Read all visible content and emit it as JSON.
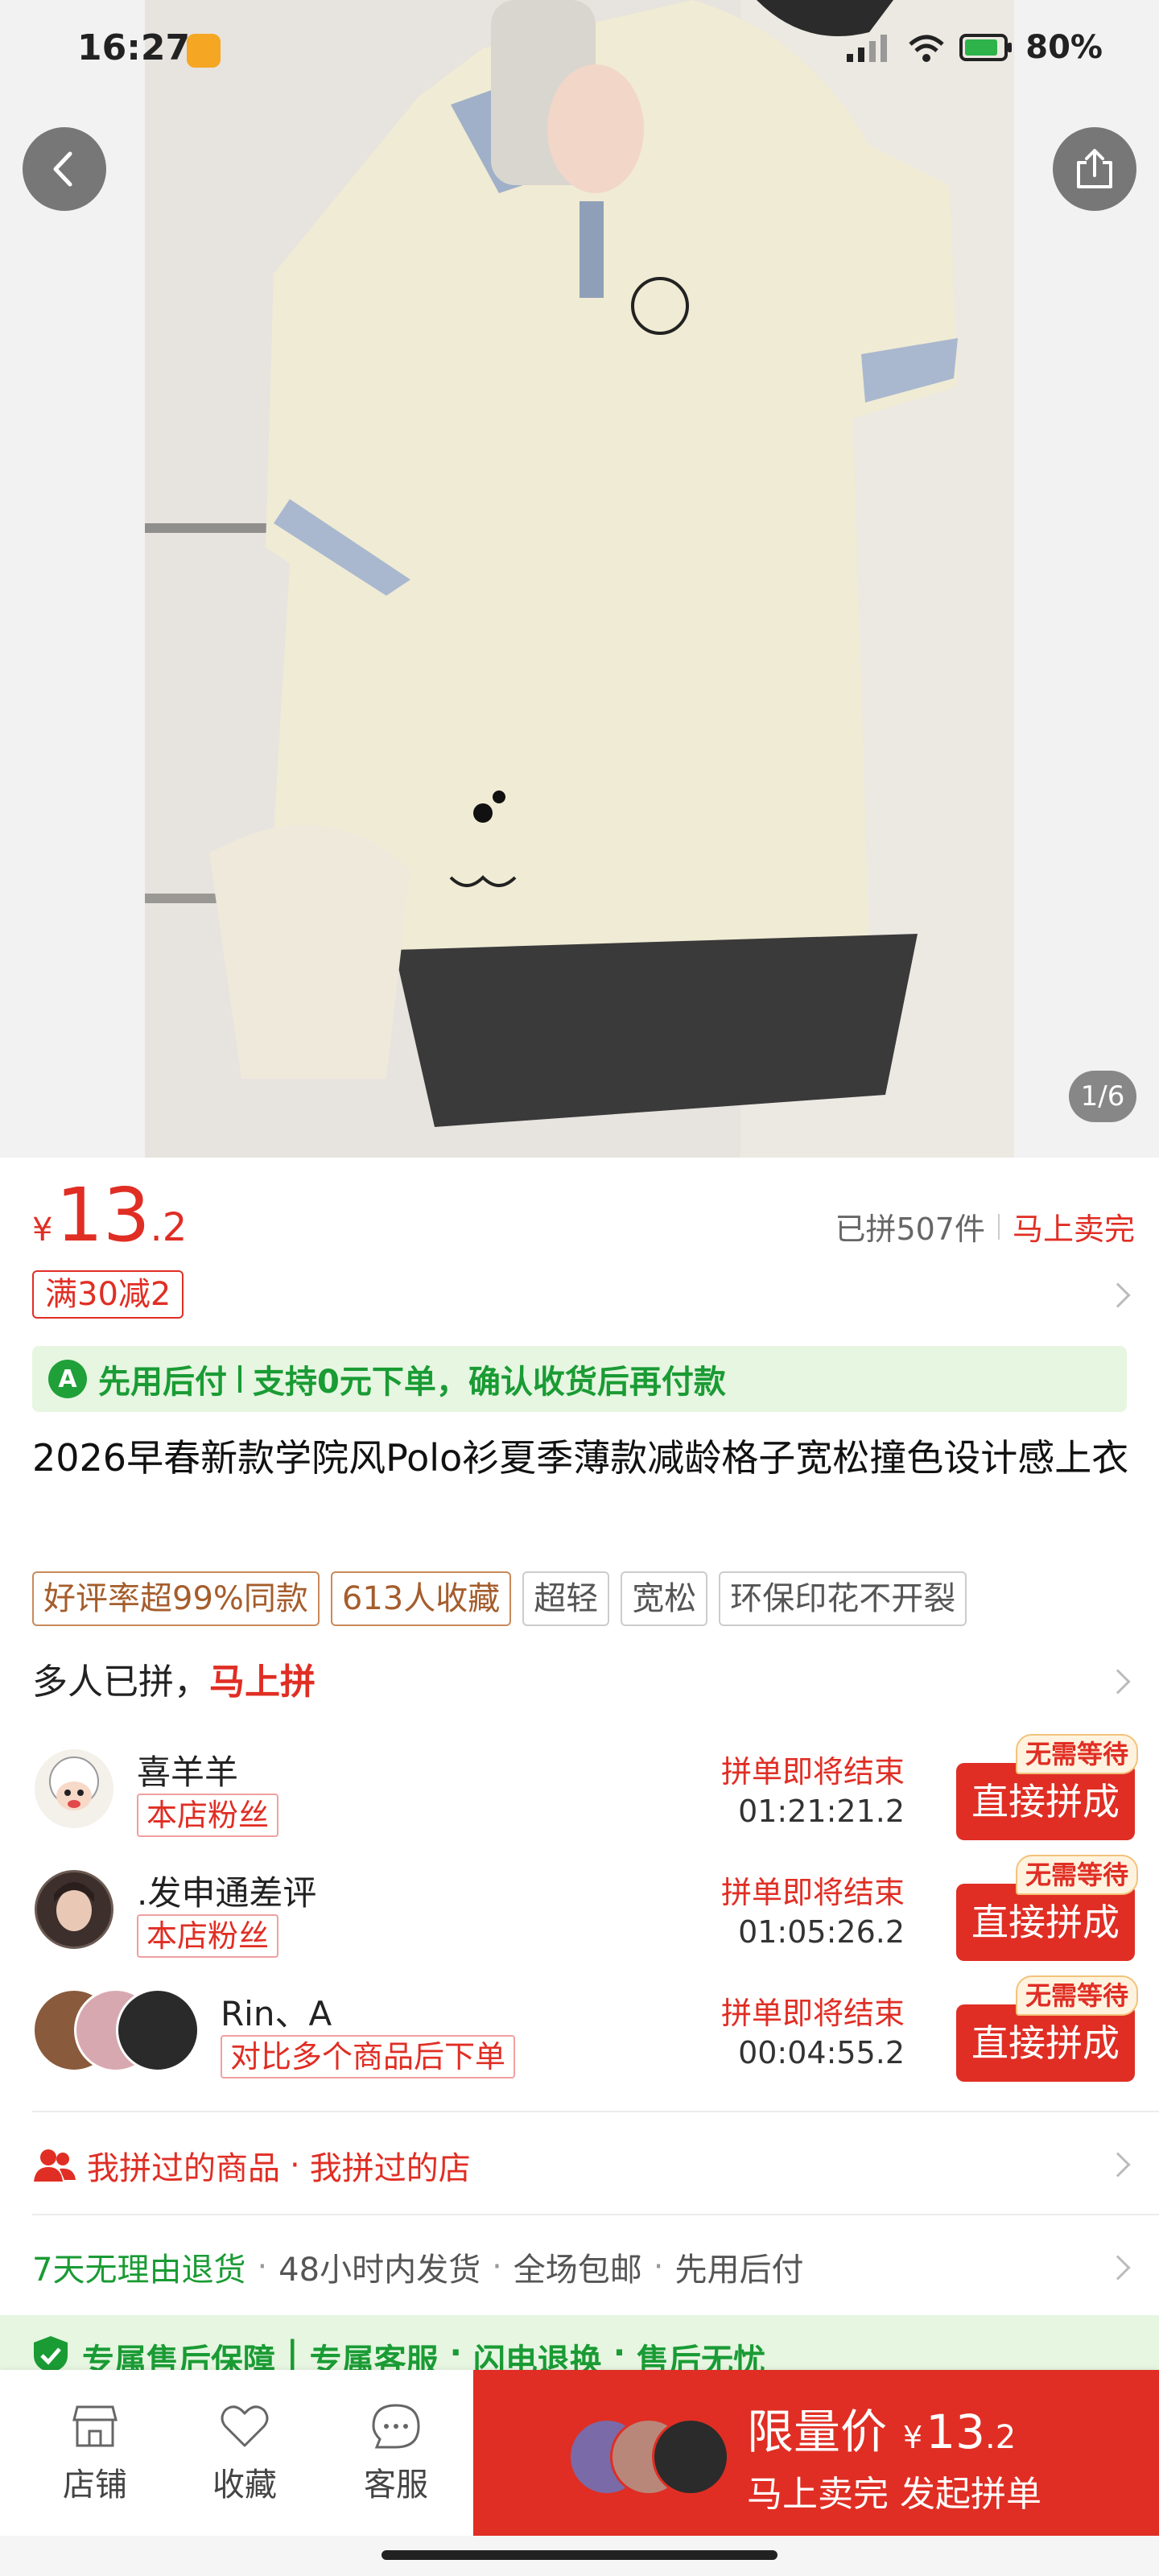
{
  "status_bar": {
    "time": "16:27",
    "battery": "80%"
  },
  "gallery": {
    "counter": "1/6"
  },
  "price": {
    "currency": "¥",
    "integer": "13",
    "decimal": ".2"
  },
  "sales": {
    "sold": "已拼507件",
    "hot": "马上卖完"
  },
  "coupon": "满30减2",
  "pay_later": {
    "badge": "A",
    "title": "先用后付",
    "desc": "支持0元下单，确认收货后再付款"
  },
  "product_title": "2026早春新款学院风Polo衫夏季薄款减龄格子宽松撞色设计感上衣",
  "tags": [
    {
      "label": "好评率超99%同款",
      "style": "gold"
    },
    {
      "label": "613人收藏",
      "style": "gold"
    },
    {
      "label": "超轻",
      "style": "plain"
    },
    {
      "label": "宽松",
      "style": "plain"
    },
    {
      "label": "环保印花不开裂",
      "style": "plain"
    }
  ],
  "group_section": {
    "prefix": "多人已拼，",
    "cta": "马上拼"
  },
  "groups": [
    {
      "name": "喜羊羊",
      "tag": "本店粉丝",
      "ending": "拼单即将结束",
      "countdown": "01:21:21.2",
      "button": "直接拼成",
      "badge": "无需等待"
    },
    {
      "name": ".发申通差评",
      "tag": "本店粉丝",
      "ending": "拼单即将结束",
      "countdown": "01:05:26.2",
      "button": "直接拼成",
      "badge": "无需等待"
    },
    {
      "name": "Rin、A",
      "tag": "对比多个商品后下单",
      "ending": "拼单即将结束",
      "countdown": "00:04:55.2",
      "button": "直接拼成",
      "badge": "无需等待"
    }
  ],
  "history_link": {
    "a": "我拼过的商品",
    "b": "我拼过的店"
  },
  "services": {
    "green": "7天无理由退货",
    "items": [
      "48小时内发货",
      "全场包邮",
      "先用后付"
    ]
  },
  "guarantee": {
    "a": "专属售后保障",
    "b": "专属客服",
    "c": "闪电退换",
    "d": "售后无忧"
  },
  "bottom_bar": {
    "store": "店铺",
    "favorite": "收藏",
    "service": "客服",
    "buy_label": "限量价",
    "buy_currency": "¥",
    "buy_integer": "13",
    "buy_decimal": ".2",
    "buy_sub": "马上卖完 发起拼单"
  },
  "colors": {
    "accent": "#e02e24",
    "green": "#1a9b34",
    "green_bg": "#e6f6e1"
  }
}
